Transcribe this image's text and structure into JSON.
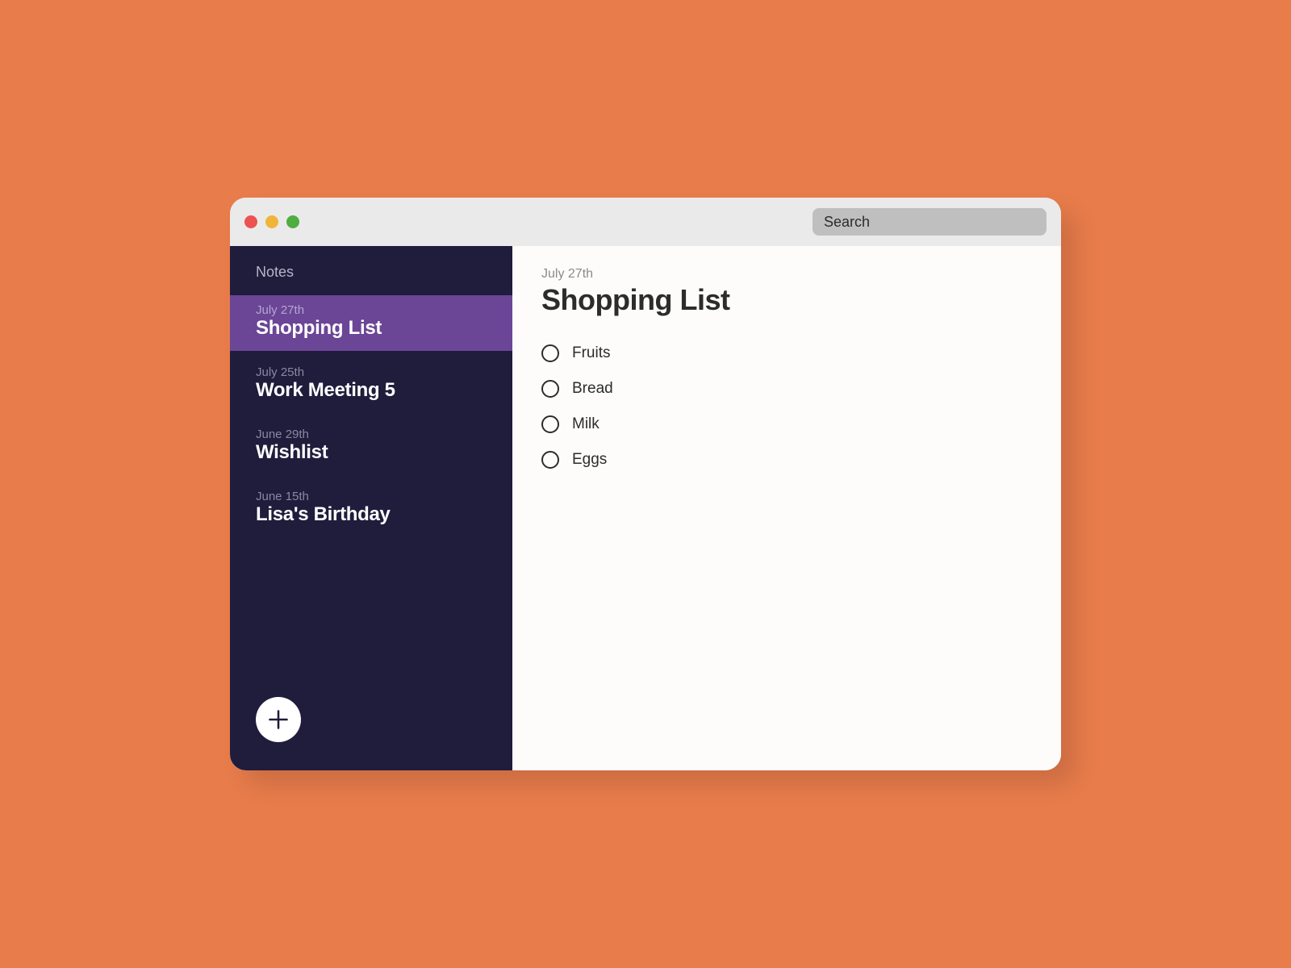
{
  "search": {
    "placeholder": "Search"
  },
  "sidebar": {
    "header": "Notes",
    "items": [
      {
        "date": "July 27th",
        "title": "Shopping List",
        "active": true
      },
      {
        "date": "July 25th",
        "title": "Work Meeting 5",
        "active": false
      },
      {
        "date": "June 29th",
        "title": "Wishlist",
        "active": false
      },
      {
        "date": "June 15th",
        "title": "Lisa's Birthday",
        "active": false
      }
    ]
  },
  "content": {
    "date": "July 27th",
    "title": "Shopping List",
    "items": [
      {
        "label": "Fruits"
      },
      {
        "label": "Bread"
      },
      {
        "label": "Milk"
      },
      {
        "label": "Eggs"
      }
    ]
  }
}
